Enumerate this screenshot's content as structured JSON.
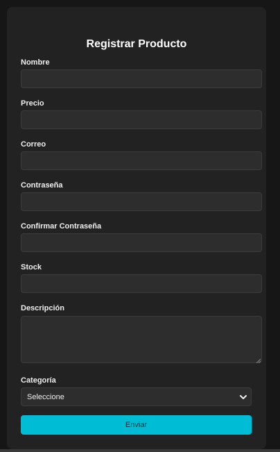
{
  "form": {
    "title": "Registrar Producto",
    "fields": [
      {
        "label": "Nombre",
        "value": ""
      },
      {
        "label": "Precio",
        "value": ""
      },
      {
        "label": "Correo",
        "value": ""
      },
      {
        "label": "Contraseña",
        "value": ""
      },
      {
        "label": "Confirmar Contraseña",
        "value": ""
      },
      {
        "label": "Stock",
        "value": ""
      }
    ],
    "description": {
      "label": "Descripción",
      "value": ""
    },
    "category": {
      "label": "Categoría",
      "selected": "Seleccione"
    },
    "submit_label": "Enviar"
  },
  "colors": {
    "page_background": "#161616",
    "card_background": "#222222",
    "input_background": "#2d2d2d",
    "accent": "#00bcd4"
  }
}
